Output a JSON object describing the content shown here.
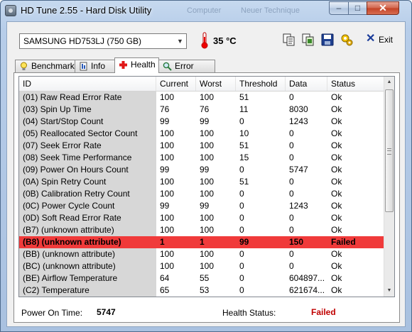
{
  "window": {
    "title": "HD Tune 2.55 - Hard Disk Utility",
    "ghost_text_1": "Computer",
    "ghost_text_2": "Neuer Technique"
  },
  "toolbar": {
    "drive": "SAMSUNG HD753LJ (750 GB)",
    "temperature": "35 °C",
    "exit_label": "Exit"
  },
  "tabs": [
    {
      "label": "Benchmark",
      "icon": "lightbulb-icon"
    },
    {
      "label": "Info",
      "icon": "info-icon"
    },
    {
      "label": "Health",
      "icon": "health-cross-icon",
      "active": true
    },
    {
      "label": "Error Scan",
      "icon": "magnifier-icon"
    }
  ],
  "table": {
    "columns": [
      "ID",
      "Current",
      "Worst",
      "Threshold",
      "Data",
      "Status"
    ],
    "rows": [
      [
        "(01) Raw Read Error Rate",
        "100",
        "100",
        "51",
        "0",
        "Ok"
      ],
      [
        "(03) Spin Up Time",
        "76",
        "76",
        "11",
        "8030",
        "Ok"
      ],
      [
        "(04) Start/Stop Count",
        "99",
        "99",
        "0",
        "1243",
        "Ok"
      ],
      [
        "(05) Reallocated Sector Count",
        "100",
        "100",
        "10",
        "0",
        "Ok"
      ],
      [
        "(07) Seek Error Rate",
        "100",
        "100",
        "51",
        "0",
        "Ok"
      ],
      [
        "(08) Seek Time Performance",
        "100",
        "100",
        "15",
        "0",
        "Ok"
      ],
      [
        "(09) Power On Hours Count",
        "99",
        "99",
        "0",
        "5747",
        "Ok"
      ],
      [
        "(0A) Spin Retry Count",
        "100",
        "100",
        "51",
        "0",
        "Ok"
      ],
      [
        "(0B) Calibration Retry Count",
        "100",
        "100",
        "0",
        "0",
        "Ok"
      ],
      [
        "(0C) Power Cycle Count",
        "99",
        "99",
        "0",
        "1243",
        "Ok"
      ],
      [
        "(0D) Soft Read Error Rate",
        "100",
        "100",
        "0",
        "0",
        "Ok"
      ],
      [
        "(B7) (unknown attribute)",
        "100",
        "100",
        "0",
        "0",
        "Ok"
      ],
      [
        "(B8) (unknown attribute)",
        "1",
        "1",
        "99",
        "150",
        "Failed"
      ],
      [
        "(BB) (unknown attribute)",
        "100",
        "100",
        "0",
        "0",
        "Ok"
      ],
      [
        "(BC) (unknown attribute)",
        "100",
        "100",
        "0",
        "0",
        "Ok"
      ],
      [
        "(BE) Airflow Temperature",
        "64",
        "55",
        "0",
        "604897...",
        "Ok"
      ],
      [
        "(C2) Temperature",
        "65",
        "53",
        "0",
        "621674...",
        "Ok"
      ]
    ],
    "failed_row_color": "#f03a3a"
  },
  "footer": {
    "power_on_label": "Power On Time:",
    "power_on_value": "5747",
    "health_label": "Health Status:",
    "health_value": "Failed",
    "health_color": "#c00000"
  }
}
